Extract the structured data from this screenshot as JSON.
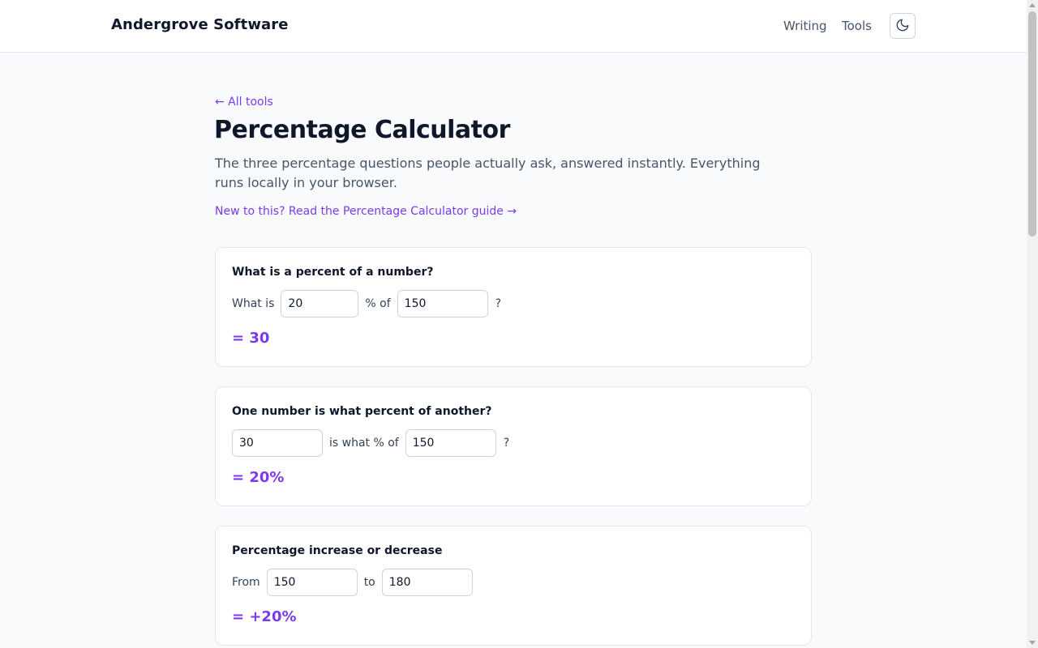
{
  "header": {
    "brand": "Andergrove Software",
    "nav": [
      {
        "label": "Writing"
      },
      {
        "label": "Tools"
      }
    ],
    "theme_toggle_icon": "moon-icon"
  },
  "main": {
    "back_link": "← All tools",
    "title": "Percentage Calculator",
    "intro": "The three percentage questions people actually ask, answered instantly. Everything runs locally in your browser.",
    "guide_link": "New to this? Read the Percentage Calculator guide →"
  },
  "calculators": [
    {
      "title": "What is a percent of a number?",
      "prefix": "What is",
      "a": "20",
      "middle": "% of",
      "b": "150",
      "suffix": "?",
      "result": "= 30"
    },
    {
      "title": "One number is what percent of another?",
      "a": "30",
      "middle": "is what % of",
      "b": "150",
      "suffix": "?",
      "result": "= 20%"
    },
    {
      "title": "Percentage increase or decrease",
      "prefix": "From",
      "a": "150",
      "middle": "to",
      "b": "180",
      "result": "= +20%"
    }
  ],
  "colors": {
    "accent": "#7c3aed",
    "text": "#0f172a",
    "muted": "#475569",
    "background": "#f8fafc",
    "border": "#e2e8f0"
  }
}
